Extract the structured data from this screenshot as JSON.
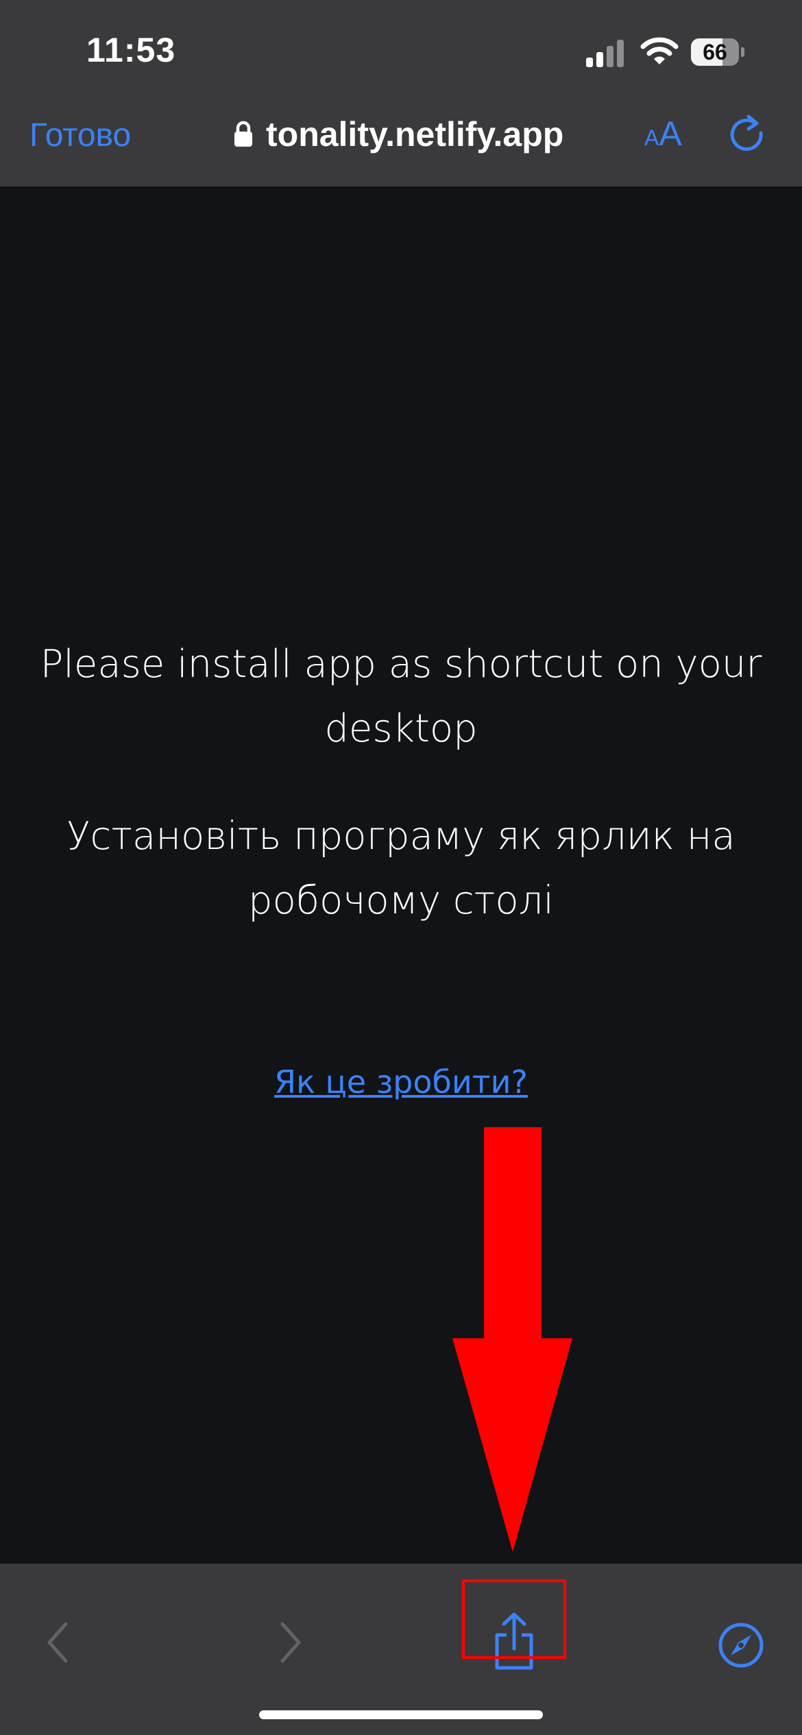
{
  "status_bar": {
    "time": "11:53",
    "battery_percent": "66",
    "battery_level": 0.66
  },
  "browser_header": {
    "done_label": "Готово",
    "url": "tonality.netlify.app",
    "text_size_small": "A",
    "text_size_large": "A"
  },
  "content": {
    "message_en": "Please install app as shortcut on your desktop",
    "message_uk": "Установіть програму як ярлик на робочому столі",
    "how_link": "Як це зробити?"
  },
  "toolbar": {
    "icons": [
      "back-icon",
      "forward-icon",
      "share-icon",
      "safari-compass-icon"
    ]
  },
  "colors": {
    "accent": "#3b82f6",
    "chrome_background": "#3a3a3c",
    "page_background": "#111317",
    "annotation": "#ff0000"
  }
}
